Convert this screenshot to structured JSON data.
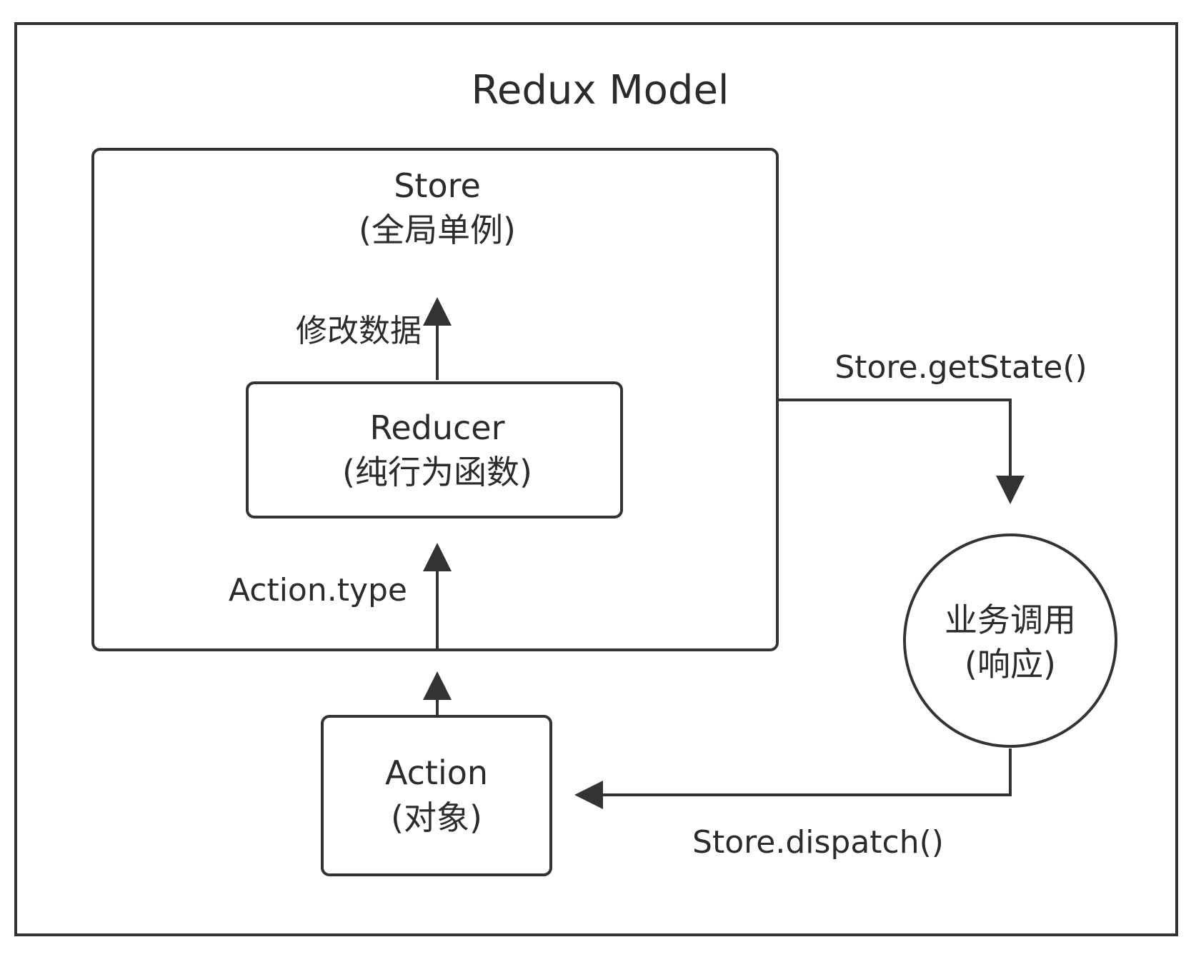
{
  "diagram": {
    "title": "Redux Model",
    "store": {
      "name": "Store",
      "desc": "(全局单例)"
    },
    "reducer": {
      "name": "Reducer",
      "desc": "(纯行为函数)"
    },
    "action": {
      "name": "Action",
      "desc": "(对象)"
    },
    "business": {
      "name": "业务调用",
      "desc": "(响应)"
    },
    "edges": {
      "modify_data": "修改数据",
      "action_type": "Action.type",
      "get_state": "Store.getState()",
      "dispatch": "Store.dispatch()"
    }
  }
}
